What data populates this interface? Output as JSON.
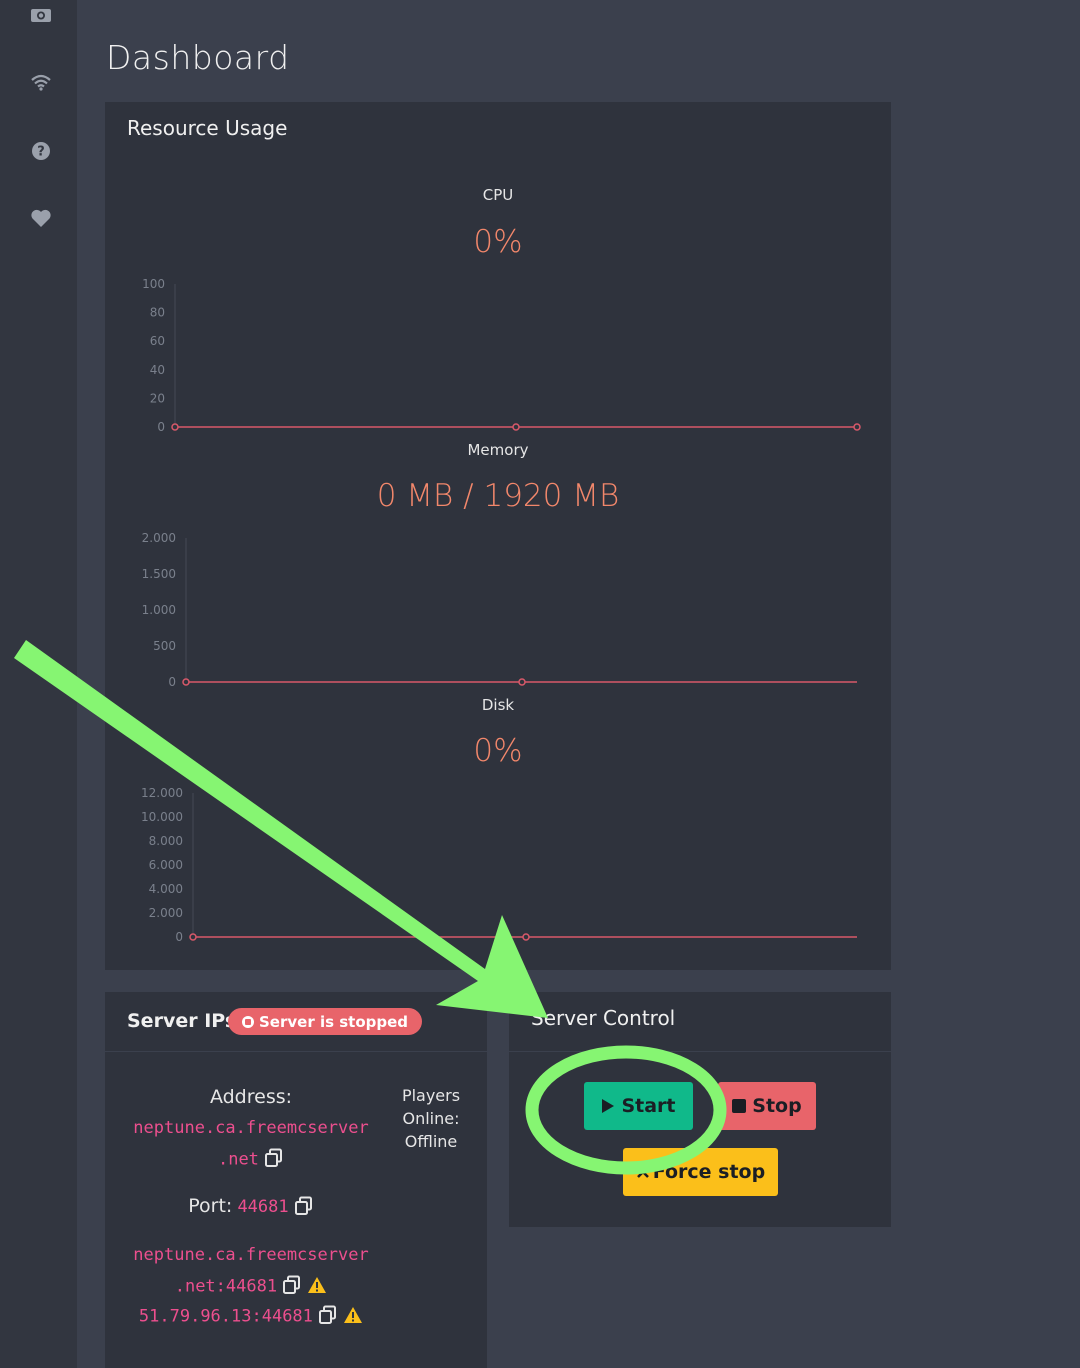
{
  "page": {
    "title": "Dashboard"
  },
  "sidebar": {
    "icons": [
      "camera-icon",
      "wifi-icon",
      "help-icon",
      "heart-icon"
    ]
  },
  "resource_usage": {
    "title": "Resource Usage",
    "cpu": {
      "label": "CPU",
      "value": "0%",
      "y_ticks": [
        "100",
        "80",
        "60",
        "40",
        "20",
        "0"
      ],
      "points": [
        0,
        0,
        0
      ]
    },
    "memory": {
      "label": "Memory",
      "value": "0 MB / 1920 MB",
      "y_ticks": [
        "2.000",
        "1.500",
        "1.000",
        "500",
        "0"
      ],
      "points": [
        0,
        0
      ]
    },
    "disk": {
      "label": "Disk",
      "value": "0%",
      "y_ticks": [
        "12.000",
        "10.000",
        "8.000",
        "6.000",
        "4.000",
        "2.000",
        "0"
      ],
      "points": [
        0,
        0
      ]
    }
  },
  "chart_data": [
    {
      "type": "line",
      "title": "CPU",
      "y_ticks": [
        "100",
        "80",
        "60",
        "40",
        "20",
        "0"
      ],
      "ylim": [
        0,
        100
      ],
      "series": [
        {
          "values": [
            0,
            0,
            0
          ]
        }
      ]
    },
    {
      "type": "line",
      "title": "Memory",
      "y_ticks": [
        "2.000",
        "1.500",
        "1.000",
        "500",
        "0"
      ],
      "ylim": [
        0,
        2000
      ],
      "series": [
        {
          "values": [
            0,
            0
          ]
        }
      ]
    },
    {
      "type": "line",
      "title": "Disk",
      "y_ticks": [
        "12.000",
        "10.000",
        "8.000",
        "6.000",
        "4.000",
        "2.000",
        "0"
      ],
      "ylim": [
        0,
        12000
      ],
      "series": [
        {
          "values": [
            0,
            0
          ]
        }
      ]
    }
  ],
  "server_ips": {
    "title": "Server IPs",
    "status_badge": "Server is stopped",
    "address_label": "Address:",
    "address_line1": "neptune.ca.freemcserver",
    "address_line2": ".net",
    "port_label": "Port:",
    "port_value": "44681",
    "full_line1": "neptune.ca.freemcserver",
    "full_line2": ".net:44681",
    "ip_port": "51.79.96.13:44681",
    "players_label_1": "Players",
    "players_label_2": "Online:",
    "players_value": "Offline"
  },
  "server_control": {
    "title": "Server Control",
    "start_label": "Start",
    "stop_label": "Stop",
    "force_stop_label": "Force stop"
  },
  "colors": {
    "background": "#3b404d",
    "panel": "#2f333d",
    "accent_orange": "#f2876b",
    "line_red": "#d9596a",
    "start_green": "#10b98a",
    "stop_red": "#e8646a",
    "force_yellow": "#fbbf1a",
    "annotation_green": "#86f572",
    "link_pink": "#ec4f8e"
  }
}
